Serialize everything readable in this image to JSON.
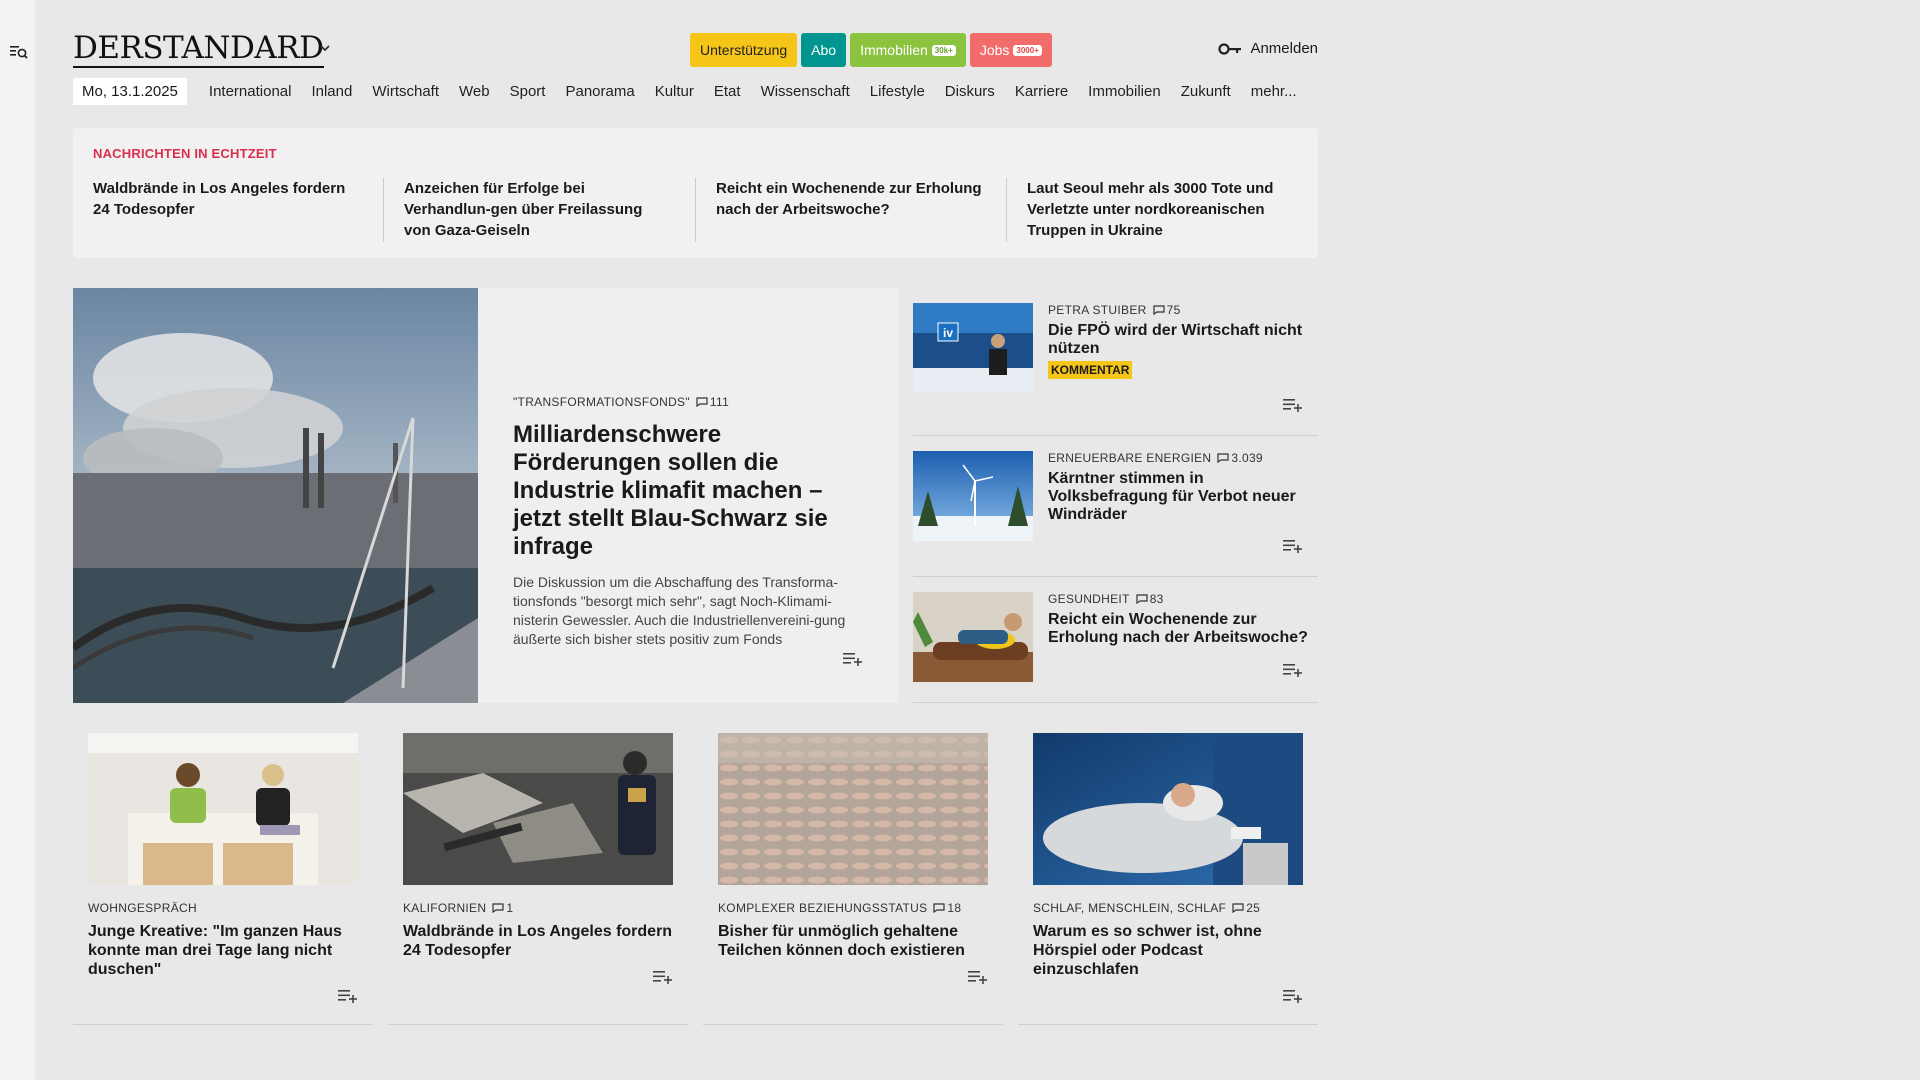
{
  "header": {
    "logo": "DERSTANDARD",
    "buttons": {
      "support": "Unterstützung",
      "abo": "Abo",
      "immobilien": "Immobilien",
      "immobilien_badge": "30k+",
      "jobs": "Jobs",
      "jobs_badge": "3000+"
    },
    "login": "Anmelden"
  },
  "nav": {
    "date": "Mo, 13.1.2025",
    "items": [
      "International",
      "Inland",
      "Wirtschaft",
      "Web",
      "Sport",
      "Panorama",
      "Kultur",
      "Etat",
      "Wissenschaft",
      "Lifestyle",
      "Diskurs",
      "Karriere",
      "Immobilien",
      "Zukunft",
      "mehr..."
    ]
  },
  "ticker": {
    "title": "NACHRICHTEN IN ECHTZEIT",
    "items": [
      "Waldbrände in Los Angeles fordern 24 Todesopfer",
      "Anzeichen für Erfolge bei Verhandlun-gen über Freilassung von Gaza-Geiseln",
      "Reicht ein Wochenende zur Erholung nach der Arbeitswoche?",
      "Laut Seoul mehr als 3000 Tote und Verletzte unter nordkoreanischen Truppen in Ukraine"
    ]
  },
  "lead": {
    "kicker": "\"TRANSFORMATIONSFONDS\"",
    "comments": "111",
    "headline": "Milliardenschwere Förderungen sollen die Industrie klimafit machen – jetzt stellt Blau-Schwarz sie infrage",
    "teaser": "Die Diskussion um die Abschaffung des Transforma-tionsfonds \"besorgt mich sehr\", sagt Noch-Klimami-nisterin Gewessler. Auch die Industriellenvereini-gung äußerte sich bisher stets positiv zum Fonds"
  },
  "side": [
    {
      "kicker": "PETRA STUIBER",
      "comments": "75",
      "headline": "Die FPÖ wird der Wirtschaft nicht nützen",
      "badge": "KOMMENTAR"
    },
    {
      "kicker": "ERNEUERBARE ENERGIEN",
      "comments": "3.039",
      "headline": "Kärntner stimmen in Volksbefragung für Verbot neuer Windräder"
    },
    {
      "kicker": "GESUNDHEIT",
      "comments": "83",
      "headline": "Reicht ein Wochenende zur Erholung nach der Arbeitswoche?"
    }
  ],
  "cards": [
    {
      "kicker": "WOHNGESPRÄCH",
      "comments": "",
      "headline": "Junge Kreative: \"Im ganzen Haus konnte man drei Tage lang nicht duschen\""
    },
    {
      "kicker": "KALIFORNIEN",
      "comments": "1",
      "headline": "Waldbrände in Los Angeles fordern 24 Todesopfer"
    },
    {
      "kicker": "KOMPLEXER BEZIEHUNGSSTATUS",
      "comments": "18",
      "headline": "Bisher für unmöglich gehaltene Teilchen können doch existieren"
    },
    {
      "kicker": "SCHLAF, MENSCHLEIN, SCHLAF",
      "comments": "25",
      "headline": "Warum es so schwer ist, ohne Hörspiel oder Podcast einzuschlafen"
    }
  ]
}
